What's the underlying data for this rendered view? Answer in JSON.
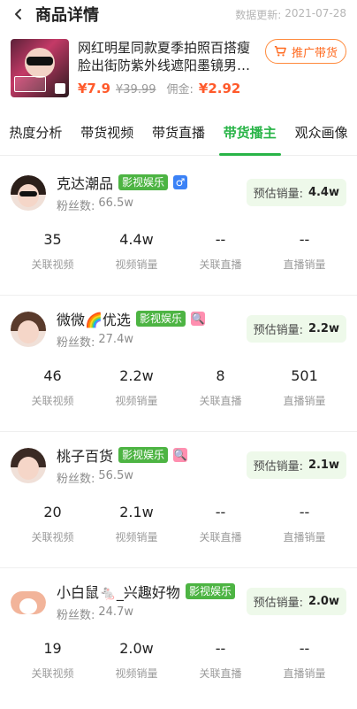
{
  "header": {
    "title": "商品详情",
    "update_label": "数据更新:",
    "update_date": "2021-07-28"
  },
  "product": {
    "title": "网红明星同款夏季拍照百搭瘦脸出街防紫外线遮阳墨镜男…",
    "price": "¥7.9",
    "orig_price": "¥39.99",
    "commission_label": "佣金:",
    "commission": "¥2.92",
    "promote_label": "推广带货"
  },
  "tabs": [
    {
      "label": "热度分析"
    },
    {
      "label": "带货视频"
    },
    {
      "label": "带货直播"
    },
    {
      "label": "带货播主"
    },
    {
      "label": "观众画像"
    }
  ],
  "anchors": [
    {
      "name": "克达潮品",
      "tag": "影视娱乐",
      "badge": "♂",
      "fans_label": "粉丝数:",
      "fans": "66.5w",
      "est_label": "预估销量:",
      "est_value": "4.4w",
      "stats": [
        {
          "num": "35",
          "label": "关联视频"
        },
        {
          "num": "4.4w",
          "label": "视频销量"
        },
        {
          "num": "--",
          "label": "关联直播"
        },
        {
          "num": "--",
          "label": "直播销量"
        }
      ]
    },
    {
      "name": "微微🌈优选",
      "tag": "影视娱乐",
      "badge": "🔍",
      "fans_label": "粉丝数:",
      "fans": "27.4w",
      "est_label": "预估销量:",
      "est_value": "2.2w",
      "stats": [
        {
          "num": "46",
          "label": "关联视频"
        },
        {
          "num": "2.2w",
          "label": "视频销量"
        },
        {
          "num": "8",
          "label": "关联直播"
        },
        {
          "num": "501",
          "label": "直播销量"
        }
      ]
    },
    {
      "name": "桃子百货",
      "tag": "影视娱乐",
      "badge": "🔍",
      "fans_label": "粉丝数:",
      "fans": "56.5w",
      "est_label": "预估销量:",
      "est_value": "2.1w",
      "stats": [
        {
          "num": "20",
          "label": "关联视频"
        },
        {
          "num": "2.1w",
          "label": "视频销量"
        },
        {
          "num": "--",
          "label": "关联直播"
        },
        {
          "num": "--",
          "label": "直播销量"
        }
      ]
    },
    {
      "name": "小白鼠🐁_兴趣好物",
      "tag": "影视娱乐",
      "badge": "",
      "fans_label": "粉丝数:",
      "fans": "24.7w",
      "est_label": "预估销量:",
      "est_value": "2.0w",
      "stats": [
        {
          "num": "19",
          "label": "关联视频"
        },
        {
          "num": "2.0w",
          "label": "视频销量"
        },
        {
          "num": "--",
          "label": "关联直播"
        },
        {
          "num": "--",
          "label": "直播销量"
        }
      ]
    }
  ],
  "colors": {
    "accent_green": "#28b447",
    "price_orange": "#ff5a2b",
    "tag_green": "#4db443"
  }
}
